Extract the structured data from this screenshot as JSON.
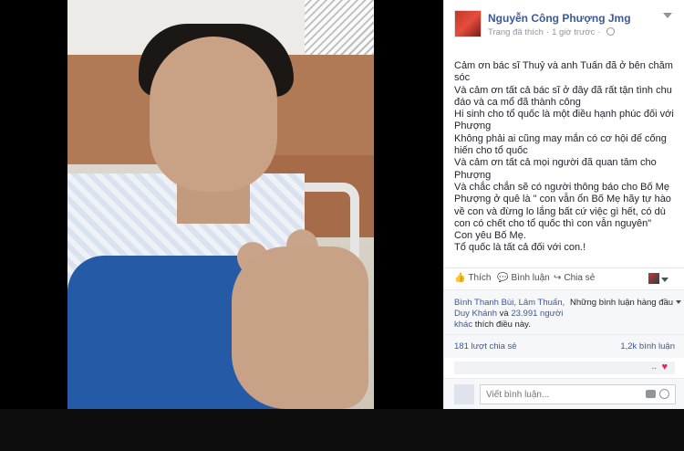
{
  "post": {
    "author": "Nguyễn Công Phượng Jmg",
    "meta_source": "Trang đã thích",
    "meta_time": "1 giờ trước",
    "paragraphs": [
      "Cảm ơn bác sĩ Thuỷ và anh Tuấn đã ở bên chăm sóc",
      "Và cảm ơn tất cả bác sĩ ở đây đã rất tận tình chu đáo và ca mổ đã thành công",
      "Hi sinh cho tổ quốc là một điều hạnh phúc đối với Phượng",
      "Không phải ai cũng may mắn có cơ hội để cống hiến cho tổ quốc",
      "Và cảm ơn tất cả mọi người đã quan tâm cho Phượng",
      "Và chắc chắn sẽ có người thông báo cho Bố Mẹ Phượng ở quê là \" con vẫn ổn Bố Mẹ hãy tự hào về con và đừng lo lắng bất cứ việc gì hết, có dù con có chết cho tổ quốc thì con vẫn nguyên\"",
      "Con yêu Bố Mẹ.",
      "Tổ quốc là tất cả đối với con.!"
    ]
  },
  "actions": {
    "like": "Thích",
    "comment": "Bình luận",
    "share": "Chia sẻ"
  },
  "likes": {
    "names": "Bình Thanh Bùi, Lâm Thuấn, Duy Khánh",
    "and": "và",
    "others": "23.991 người khác",
    "suffix": "thích điều này.",
    "top_comments": "Những bình luận hàng đầu"
  },
  "stats": {
    "shares": "181 lượt chia sẻ",
    "comments": "1,2k bình luận"
  },
  "comment_stub": {
    "dots": ".."
  },
  "composer": {
    "placeholder": "Viết bình luận..."
  },
  "icons": {
    "like": "thumbs-up-icon",
    "comment": "speech-bubble-icon",
    "share": "share-arrow-icon",
    "privacy": "globe-icon",
    "reaction": "heart-icon"
  },
  "colors": {
    "link": "#3b5998",
    "text": "#1d2129",
    "muted": "#90949c",
    "heart": "#e0245e"
  }
}
